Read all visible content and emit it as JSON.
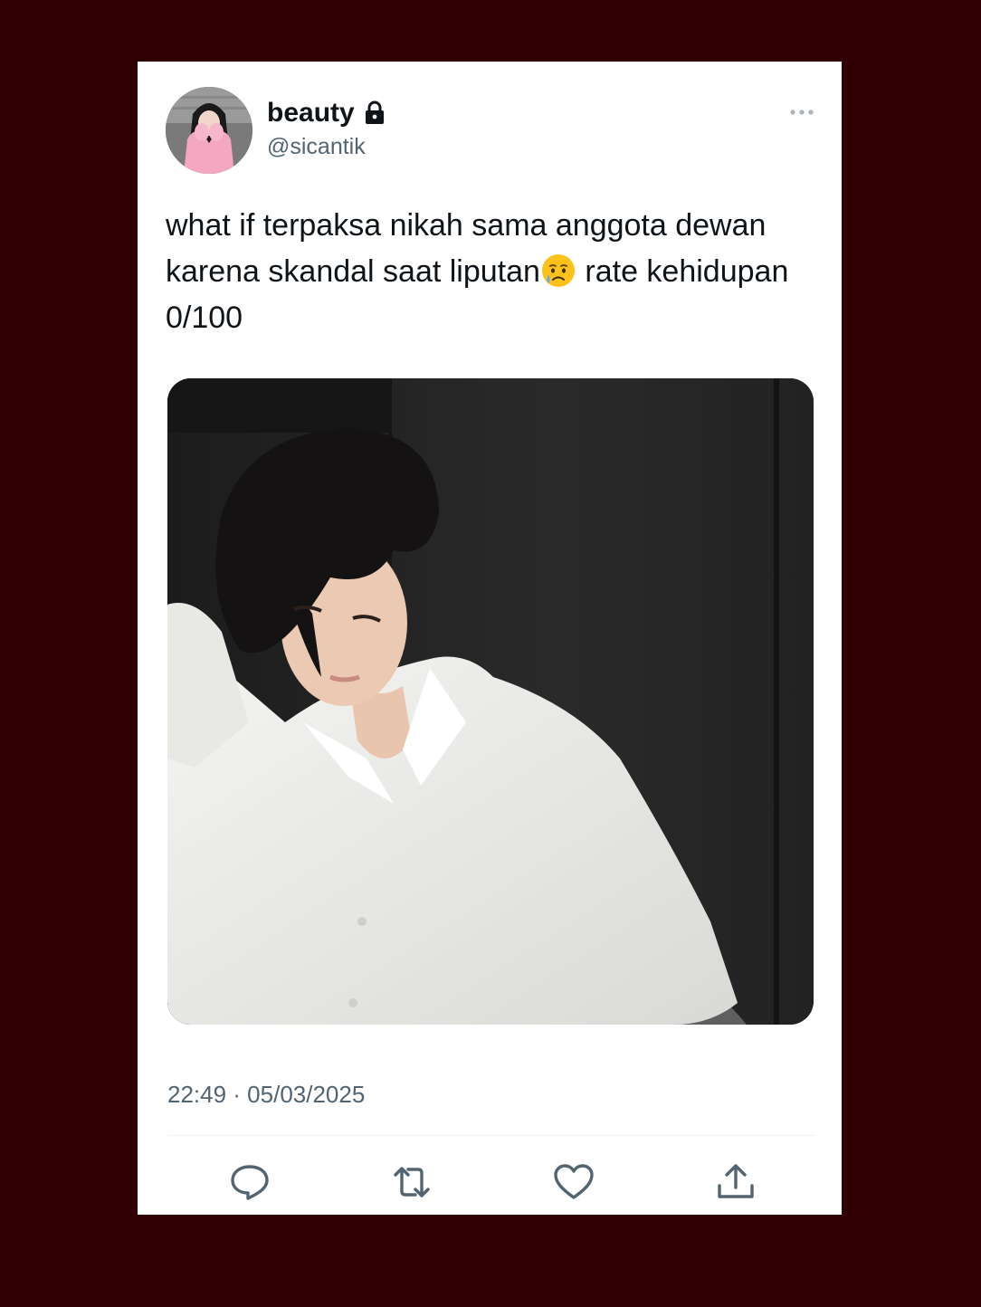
{
  "tweet": {
    "author": {
      "display_name": "beauty",
      "handle": "@sicantik",
      "protected_icon": "lock-icon",
      "avatar_image": "profile photo of a woman in a pink sweater covering her face"
    },
    "more_icon": "more-horizontal-icon",
    "text_part1": "what if terpaksa nikah sama anggota dewan karena skandal saat liputan",
    "emoji": "crying-face-emoji",
    "text_part2": " rate kehidupan 0/100",
    "media": {
      "image": "photo of a young man with dark hair in a white shirt against a dark wall"
    },
    "timestamp": "22:49 · 05/03/2025",
    "actions": [
      "reply-icon",
      "retweet-icon",
      "like-icon",
      "share-icon"
    ]
  },
  "colors": {
    "background": "#300005",
    "card": "#ffffff",
    "text_primary": "#0f1419",
    "text_secondary": "#536471",
    "divider": "#eff3f4"
  }
}
